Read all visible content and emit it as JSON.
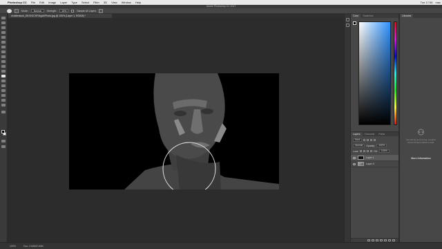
{
  "menubar": {
    "app_name": "Photoshop CC",
    "items": [
      "File",
      "Edit",
      "Image",
      "Layer",
      "Type",
      "Select",
      "Filter",
      "3D",
      "View",
      "Window",
      "Help"
    ],
    "status": [
      "Tue 17:56",
      "mac"
    ]
  },
  "window": {
    "title": "Adobe Photoshop CC 2017"
  },
  "options_bar": {
    "mode_label": "Mode:",
    "mode_value": "Normal",
    "strength_label": "Strength:",
    "strength_value": "15%",
    "sample_all_label": "Sample All Layers"
  },
  "document": {
    "tab_label": "shutterstock_DKXHJCKF4tyjdXPhoto.jpg @ 100% (Layer 1, RGB/8) *"
  },
  "color_panel": {
    "tabs": [
      "Color",
      "Swatches"
    ],
    "foreground": "#000000",
    "background": "#ffffff"
  },
  "layers_panel": {
    "tabs": [
      "Layers",
      "Channels",
      "Paths"
    ],
    "kind_label": "Kind",
    "blend_mode": "Normal",
    "opacity_label": "Opacity:",
    "opacity_value": "100%",
    "lock_label": "Lock:",
    "fill_label": "Fill:",
    "fill_value": "100%",
    "layers": [
      {
        "name": "Layer 1",
        "selected": true
      },
      {
        "name": "Layer 0",
        "selected": false
      }
    ]
  },
  "libraries_panel": {
    "tab": "Libraries",
    "message": "Something went wrong. Creative Cloud Libraries failed to load.",
    "link": "More Information"
  },
  "statusbar": {
    "zoom": "100%",
    "doc_info": "Doc: 2.64M/2.64M"
  },
  "colors": {
    "accent": "#2e92ff",
    "panel": "#474747",
    "canvas": "#2c2c2c"
  }
}
